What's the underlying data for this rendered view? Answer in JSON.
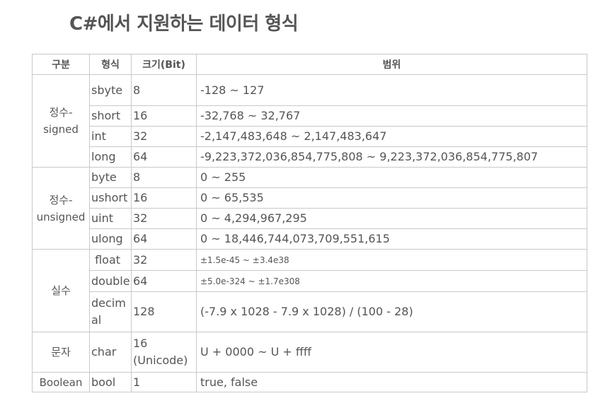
{
  "title": "C#에서 지원하는 데이터 형식",
  "table": {
    "headers": [
      "구분",
      "형식",
      "크기(Bit)",
      "범위"
    ],
    "categories": {
      "signed": [
        "정수-",
        "signed"
      ],
      "unsigned": [
        "정수-",
        "unsigned"
      ],
      "real": "실수",
      "char": "문자",
      "bool": "Boolean"
    },
    "rows": [
      {
        "type": "sbyte",
        "size": "8",
        "range": "-128 ~ 127"
      },
      {
        "type": "short",
        "size": "16",
        "range": "-32,768 ~ 32,767"
      },
      {
        "type": "int",
        "size": "32",
        "range": "-2,147,483,648 ~ 2,147,483,647"
      },
      {
        "type": "long",
        "size": "64",
        "range": "-9,223,372,036,854,775,808 ~ 9,223,372,036,854,775,807"
      },
      {
        "type": "byte",
        "size": "8",
        "range": "0 ~ 255"
      },
      {
        "type": "ushort",
        "size": "16",
        "range": "0 ~ 65,535"
      },
      {
        "type": "uint",
        "size": "32",
        "range": "0 ~ 4,294,967,295"
      },
      {
        "type": "ulong",
        "size": "64",
        "range": "0 ~ 18,446,744,073,709,551,615"
      },
      {
        "type": " float",
        "size": "32",
        "range": "±1.5e-45 ~ ±3.4e38"
      },
      {
        "type": "double",
        "size": "64",
        "range": "±5.0e-324 ~ ±1.7e308"
      },
      {
        "type": "decimal",
        "size": "128",
        "range": "(-7.9 x 1028 - 7.9 x 1028) / (100 - 28)"
      },
      {
        "type": "char",
        "size": "16 (Unicode)",
        "range": "U + 0000 ~ U + ffff"
      },
      {
        "type": "bool",
        "size": "1",
        "range": "true, false"
      }
    ]
  }
}
